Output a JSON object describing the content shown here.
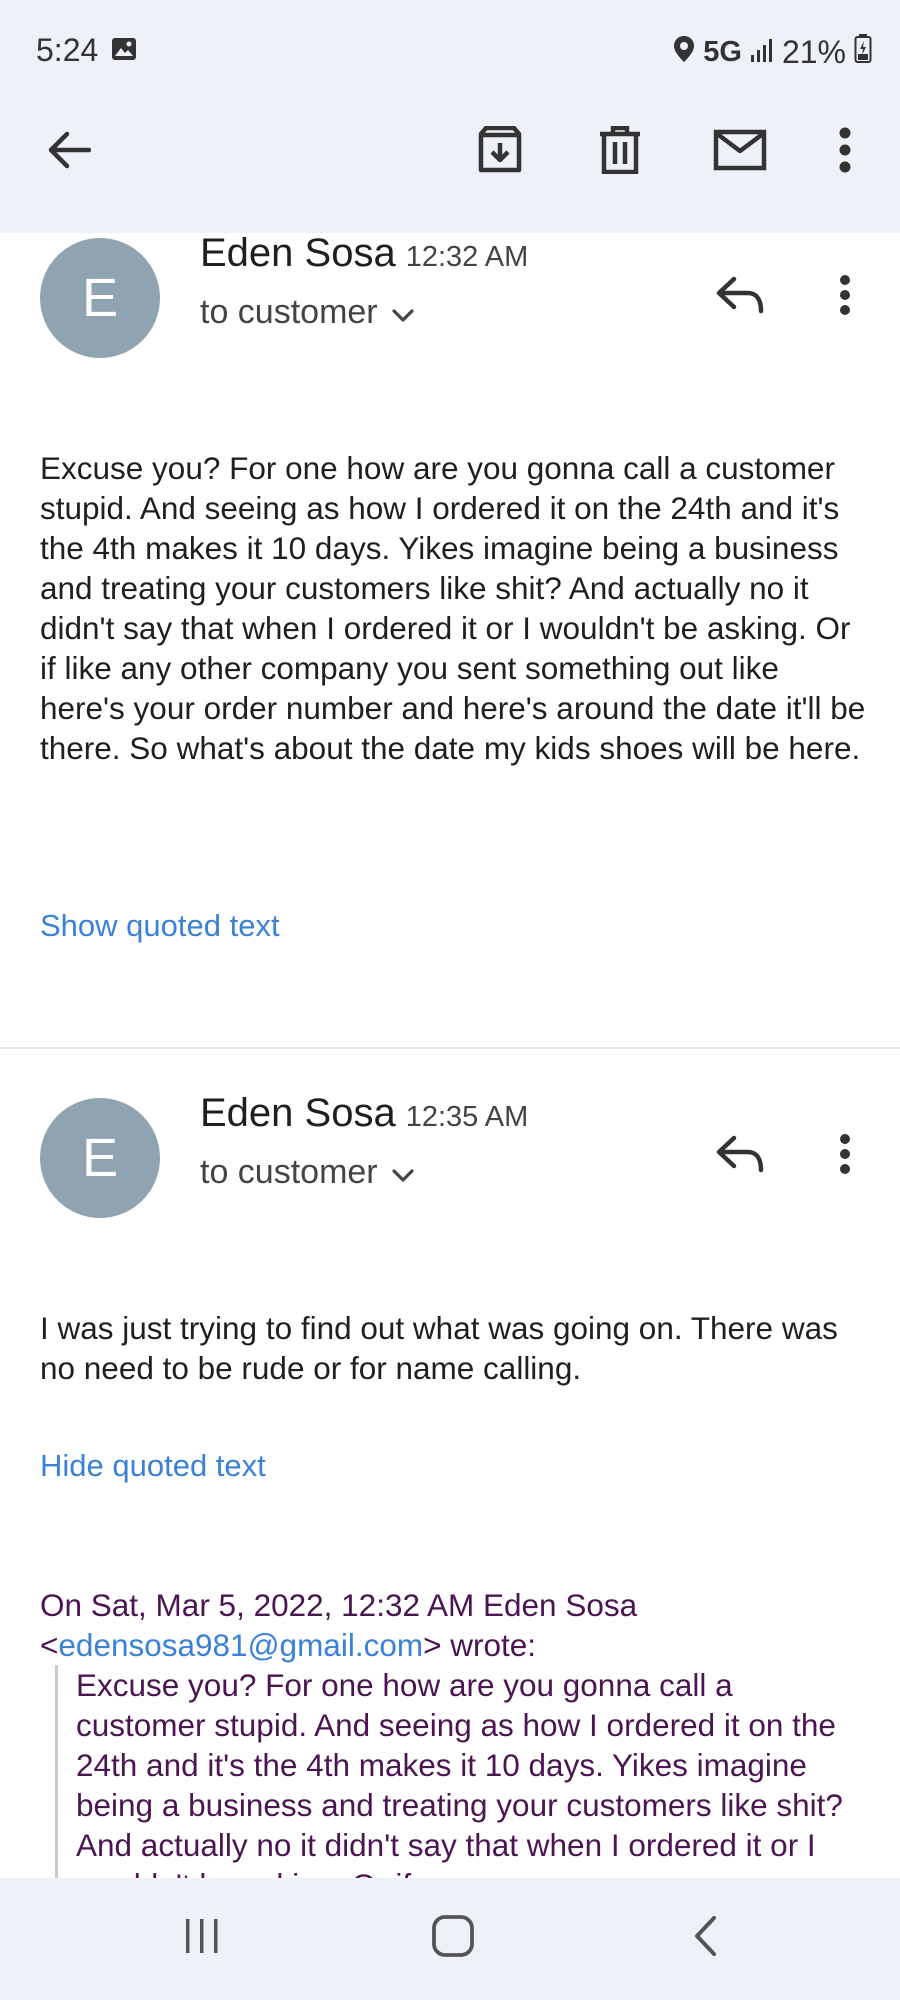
{
  "status": {
    "time": "5:24",
    "network": "5G",
    "battery": "21%",
    "icons": [
      "image-icon",
      "location-icon",
      "signal-icon",
      "battery-icon"
    ]
  },
  "toolbar": {
    "icons": [
      "back-arrow-icon",
      "archive-icon",
      "trash-icon",
      "mail-unread-icon",
      "more-vert-icon"
    ]
  },
  "messages": [
    {
      "avatar_letter": "E",
      "sender": "Eden Sosa",
      "time": "12:32 AM",
      "recipient": "to customer",
      "body": "Excuse you? For one how are you gonna call a customer stupid. And seeing as how I ordered it on the 24th and it's the 4th makes it 10 days. Yikes imagine being a business and treating your customers like shit? And actually no it didn't say that when I ordered it or I wouldn't be asking. Or if like any other company you sent something out like here's your order number and here's around the date it'll be there. So what's about the date my kids shoes will be here.",
      "quote_toggle": "Show quoted text"
    },
    {
      "avatar_letter": "E",
      "sender": "Eden Sosa",
      "time": "12:35 AM",
      "recipient": "to customer",
      "body": "I was just trying to find out what was going on. There was no need to be rude or for name calling.",
      "quote_toggle": "Hide quoted text",
      "quoted_header_prefix": "On Sat, Mar 5, 2022, 12:32 AM Eden Sosa",
      "quoted_email": "edensosa981@gmail.com",
      "quoted_suffix": "wrote:",
      "quoted_body": "Excuse you? For one how are you gonna call a customer stupid. And seeing as how I ordered it on the 24th and it's the 4th makes it 10 days. Yikes imagine being a business and treating your customers like shit? And actually no it didn't say that when I ordered it or I wouldn't be asking. Or if"
    }
  ],
  "colors": {
    "accent_link": "#3b82d6",
    "quote_text": "#4a1550",
    "avatar": "#8fa3b0",
    "chrome_bg": "#eef1f8"
  }
}
